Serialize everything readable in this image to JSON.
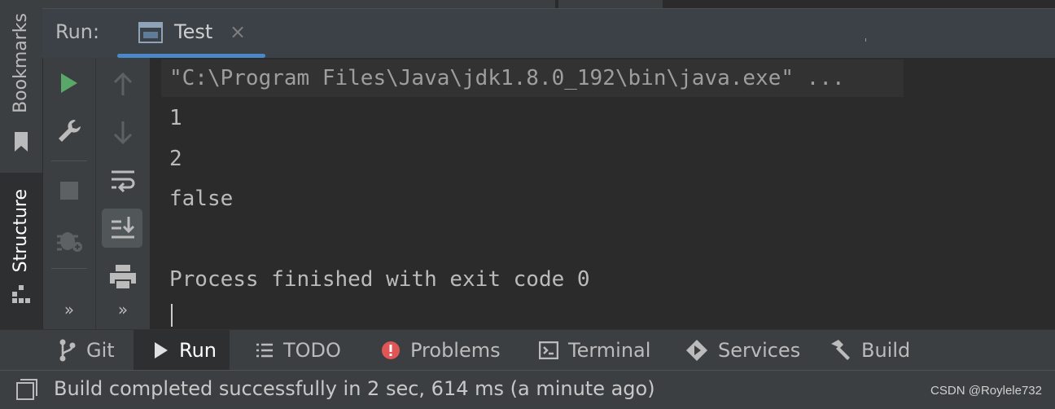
{
  "side_stripe": {
    "bookmarks_label": "Bookmarks",
    "structure_label": "Structure"
  },
  "run_panel": {
    "title": "Run:",
    "tab_label": "Test",
    "tab_close_glyph": "×",
    "more_glyph": "»"
  },
  "console": {
    "lines": [
      "\"C:\\Program Files\\Java\\jdk1.8.0_192\\bin\\java.exe\" ...",
      "1",
      "2",
      "false",
      "",
      "Process finished with exit code 0"
    ]
  },
  "bottom_tabs": {
    "git": "Git",
    "run": "Run",
    "todo": "TODO",
    "problems": "Problems",
    "terminal": "Terminal",
    "services": "Services",
    "build": "Build"
  },
  "status": {
    "message": "Build completed successfully in 2 sec, 614 ms (a minute ago)",
    "watermark": "CSDN @Roylele732"
  },
  "icons": {
    "run": "play-icon",
    "settings": "wrench-icon",
    "stop": "stop-icon",
    "debug": "debug-icon",
    "up": "arrow-up-icon",
    "down": "arrow-down-icon",
    "wrap": "soft-wrap-icon",
    "scroll": "scroll-to-end-icon",
    "print": "print-icon"
  },
  "colors": {
    "accent_underline": "#4a88c7",
    "run_green": "#59a869",
    "problems_red": "#e05555",
    "background": "#2b2b2b",
    "panel": "#3c3f41"
  }
}
